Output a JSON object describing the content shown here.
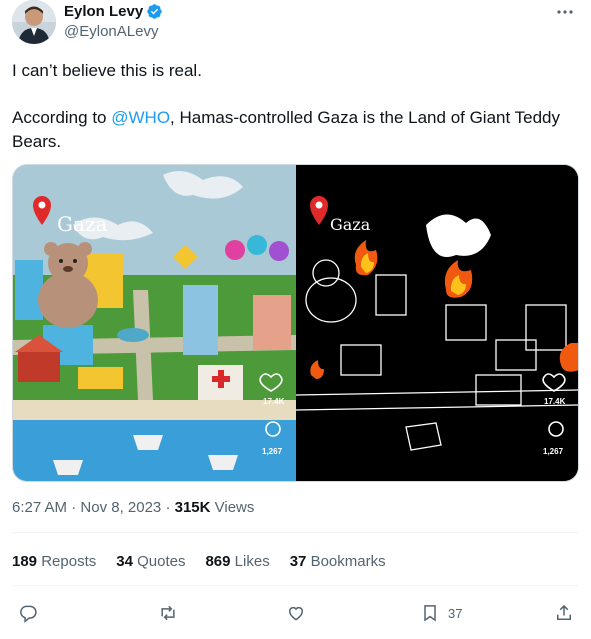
{
  "author": {
    "name": "Eylon Levy",
    "handle": "@EylonALevy",
    "verified_color": "#1d9bf0"
  },
  "tweet": {
    "line1": "I can’t believe this is real.",
    "line2_prefix": "According to ",
    "mention": "@WHO",
    "line2_suffix": ", Hamas-controlled Gaza is the Land of Giant Teddy Bears."
  },
  "media": {
    "left": {
      "label": "Gaza",
      "likes": "17.4K",
      "comments": "1,267"
    },
    "right": {
      "label": "Gaza",
      "likes": "17.4K",
      "comments": "1,267"
    }
  },
  "meta": {
    "time": "6:27 AM",
    "separator1": " · ",
    "date": "Nov 8, 2023",
    "separator2": " · ",
    "views_count": "315K",
    "views_label": " Views"
  },
  "stats": {
    "reposts_count": "189",
    "reposts_label": "Reposts",
    "quotes_count": "34",
    "quotes_label": "Quotes",
    "likes_count": "869",
    "likes_label": "Likes",
    "bookmarks_count": "37",
    "bookmarks_label": "Bookmarks"
  },
  "actions": {
    "reply_icon": "reply-icon",
    "repost_icon": "repost-icon",
    "like_icon": "heart-icon",
    "bookmark_icon": "bookmark-icon",
    "bookmark_count": "37",
    "share_icon": "share-icon"
  },
  "colors": {
    "accent": "#1d9bf0",
    "text": "#0f1419",
    "muted": "#536471"
  }
}
